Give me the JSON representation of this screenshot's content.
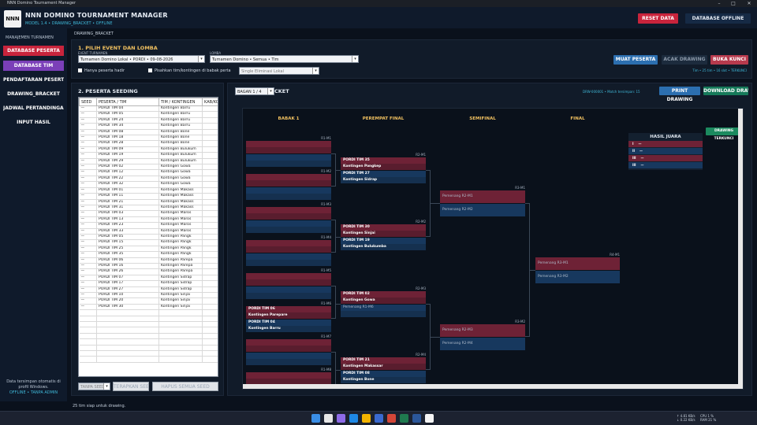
{
  "window": {
    "title": "NNN Domino Tournament Manager",
    "minimize": "–",
    "maximize": "□",
    "close": "✕"
  },
  "header": {
    "logo": "NNN",
    "title": "NNN DOMINO TOURNAMENT MANAGER",
    "subtitle": "MODEL 1.4 • DRAWING_BRACKET • OFFLINE",
    "reset_label": "RESET DATA",
    "offline_label": "DATABASE OFFLINE"
  },
  "sidebar": {
    "section": "MANAJEMEN TURNAMEN",
    "items": [
      {
        "label": "DATABASE PESERTA"
      },
      {
        "label": "DATABASE TIM"
      },
      {
        "label": "PENDAFTARAN PESERTA"
      },
      {
        "label": "DRAWING_BRACKET"
      },
      {
        "label": "JADWAL PERTANDINGAN"
      },
      {
        "label": "INPUT HASIL"
      }
    ],
    "note": "Data tersimpan otomatis di profil Windows.",
    "status": "OFFLINE • TANPA ADMIN"
  },
  "breadcrumb": "DRAWING_BRACKET",
  "event": {
    "section_title": "1. PILIH EVENT DAN LOMBA",
    "event_label": "EVENT TURNAMEN",
    "event_value": "Turnamen Domino Lokal • PORDI • 09-08-2026",
    "lomba_label": "LOMBA",
    "lomba_value": "Turnamen Domino • Semua • Tim",
    "chk_hadir": "Hanya peserta hadir",
    "chk_pisahkan": "Pisahkan tim/kontingen di babak perta",
    "format_value": "Single Eliminasi Lokal",
    "btn_muat": "MUAT PESERTA",
    "btn_acak": "ACAK DRAWING",
    "btn_buka": "BUKA KUNCI",
    "status": "Tim • 25 tim • 16 slot • TERKUNCI"
  },
  "seeding": {
    "title": "2. PESERTA   SEEDING",
    "columns": [
      "SEED",
      "PESERTA / TIM",
      "TIM / KONTINGEN",
      "KAB/KO"
    ],
    "rows": [
      [
        "—",
        "PORDI TIM 04",
        "Kontingen Barru",
        ""
      ],
      [
        "—",
        "PORDI TIM 05",
        "Kontingen Barru",
        ""
      ],
      [
        "—",
        "PORDI TIM 24",
        "Kontingen Barru",
        ""
      ],
      [
        "—",
        "PORDI TIM 34",
        "Kontingen Barru",
        ""
      ],
      [
        "—",
        "PORDI TIM 08",
        "Kontingen Bone",
        ""
      ],
      [
        "—",
        "PORDI TIM 18",
        "Kontingen Bone",
        ""
      ],
      [
        "—",
        "PORDI TIM 28",
        "Kontingen Bone",
        ""
      ],
      [
        "—",
        "PORDI TIM 09",
        "Kontingen Bulukum",
        ""
      ],
      [
        "—",
        "PORDI TIM 19",
        "Kontingen Bulukum",
        ""
      ],
      [
        "—",
        "PORDI TIM 29",
        "Kontingen Bulukum",
        ""
      ],
      [
        "—",
        "PORDI TIM 02",
        "Kontingen Gowa",
        ""
      ],
      [
        "—",
        "PORDI TIM 12",
        "Kontingen Gowa",
        ""
      ],
      [
        "—",
        "PORDI TIM 22",
        "Kontingen Gowa",
        ""
      ],
      [
        "—",
        "PORDI TIM 32",
        "Kontingen Gowa",
        ""
      ],
      [
        "—",
        "PORDI TIM 01",
        "Kontingen Makass",
        ""
      ],
      [
        "—",
        "PORDI TIM 11",
        "Kontingen Makass",
        ""
      ],
      [
        "—",
        "PORDI TIM 21",
        "Kontingen Makass",
        ""
      ],
      [
        "—",
        "PORDI TIM 31",
        "Kontingen Makass",
        ""
      ],
      [
        "—",
        "PORDI TIM 03",
        "Kontingen Maros",
        ""
      ],
      [
        "—",
        "PORDI TIM 13",
        "Kontingen Maros",
        ""
      ],
      [
        "—",
        "PORDI TIM 23",
        "Kontingen Maros",
        ""
      ],
      [
        "—",
        "PORDI TIM 33",
        "Kontingen Maros",
        ""
      ],
      [
        "—",
        "PORDI TIM 05",
        "Kontingen Pangk",
        ""
      ],
      [
        "—",
        "PORDI TIM 15",
        "Kontingen Pangk",
        ""
      ],
      [
        "—",
        "PORDI TIM 25",
        "Kontingen Pangk",
        ""
      ],
      [
        "—",
        "PORDI TIM 35",
        "Kontingen Pangk",
        ""
      ],
      [
        "—",
        "PORDI TIM 06",
        "Kontingen Parepa",
        ""
      ],
      [
        "—",
        "PORDI TIM 16",
        "Kontingen Parepa",
        ""
      ],
      [
        "—",
        "PORDI TIM 26",
        "Kontingen Parepa",
        ""
      ],
      [
        "—",
        "PORDI TIM 07",
        "Kontingen Sidrap",
        ""
      ],
      [
        "—",
        "PORDI TIM 17",
        "Kontingen Sidrap",
        ""
      ],
      [
        "—",
        "PORDI TIM 27",
        "Kontingen Sidrap",
        ""
      ],
      [
        "—",
        "PORDI TIM 10",
        "Kontingen Sinjai",
        ""
      ],
      [
        "—",
        "PORDI TIM 20",
        "Kontingen Sinjai",
        ""
      ],
      [
        "—",
        "PORDI TIM 30",
        "Kontingen Sinjai",
        ""
      ]
    ],
    "seed_placeholder": "TANPA SEED",
    "btn_terapkan": "TERAPKAN SEED",
    "btn_hapus": "HAPUS SEMUA SEED"
  },
  "bracket": {
    "page_value": "BAGAN 1 / 4",
    "title_tail": "CKET",
    "info": "DRW-000001 • Match tersimpan: 15",
    "btn_print": "PRINT DRAWING",
    "btn_download": "DOWNLOAD DRAWING",
    "btn_terkunci": "DRAWING TERKUNCI",
    "rounds": [
      "BABAK 1",
      "PEREMPAT FINAL",
      "SEMIFINAL",
      "FINAL"
    ],
    "r1": [
      {
        "code": "R1-M1",
        "top": "",
        "top_sub": "",
        "bot": "",
        "bot_sub": ""
      },
      {
        "code": "R1-M2",
        "top": "",
        "top_sub": "",
        "bot": "",
        "bot_sub": ""
      },
      {
        "code": "R1-M3",
        "top": "",
        "top_sub": "",
        "bot": "",
        "bot_sub": ""
      },
      {
        "code": "R1-M4",
        "top": "",
        "top_sub": "",
        "bot": "",
        "bot_sub": ""
      },
      {
        "code": "R1-M5",
        "top": "",
        "top_sub": "",
        "bot": "",
        "bot_sub": ""
      },
      {
        "code": "R1-M6",
        "top": "PORDI TIM 06",
        "top_sub": "Kontingen Parepare",
        "bot": "PORDI TIM 04",
        "bot_sub": "Kontingen Barru"
      },
      {
        "code": "R1-M7",
        "top": "",
        "top_sub": "",
        "bot": "",
        "bot_sub": ""
      },
      {
        "code": "R1-M8",
        "top": "",
        "top_sub": "",
        "bot": "",
        "bot_sub": ""
      }
    ],
    "r2": [
      {
        "code": "R2-M1",
        "top": "PORDI TIM 35",
        "top_sub": "Kontingen Pangkep",
        "bot": "PORDI TIM 27",
        "bot_sub": "Kontingen Sidrap"
      },
      {
        "code": "R2-M2",
        "top": "PORDI TIM 30",
        "top_sub": "Kontingen Sinjai",
        "bot": "PORDI TIM 19",
        "bot_sub": "Kontingen Bulukumba"
      },
      {
        "code": "R2-M3",
        "top": "PORDI TIM 02",
        "top_sub": "Kontingen Gowa",
        "bot": "Pemenang R1-M6",
        "bot_sub": ""
      },
      {
        "code": "R2-M4",
        "top": "PORDI TIM 21",
        "top_sub": "Kontingen Makassar",
        "bot": "PORDI TIM 08",
        "bot_sub": "Kontingen Bone"
      }
    ],
    "r3": [
      {
        "code": "R3-M1",
        "top": "Pemenang R2-M1",
        "bot": "Pemenang R2-M2"
      },
      {
        "code": "R3-M2",
        "top": "Pemenang R2-M3",
        "bot": "Pemenang R2-M4"
      }
    ],
    "r4": [
      {
        "code": "R4-M1",
        "top": "Pemenang R3-M1",
        "bot": "Pemenang R3-M2"
      }
    ],
    "hasil": {
      "title": "HASIL JUARA",
      "rows": [
        {
          "rank": "I",
          "name": "—"
        },
        {
          "rank": "II",
          "name": "—"
        },
        {
          "rank": "III",
          "name": "—"
        },
        {
          "rank": "III",
          "name": "—"
        }
      ]
    }
  },
  "statusbar": "25 tim siap untuk drawing.",
  "tray": {
    "net": "↑ 4.81 KB/s\n↓ 0.22 KB/s",
    "cpu": "CPU 1 %\nRAM 21 %"
  },
  "colors": {
    "accent_red": "#c8243c",
    "accent_purple": "#7b3fb8",
    "accent_blue": "#2c6fb0",
    "gold": "#f0c060",
    "teal": "#3fb8d8"
  }
}
